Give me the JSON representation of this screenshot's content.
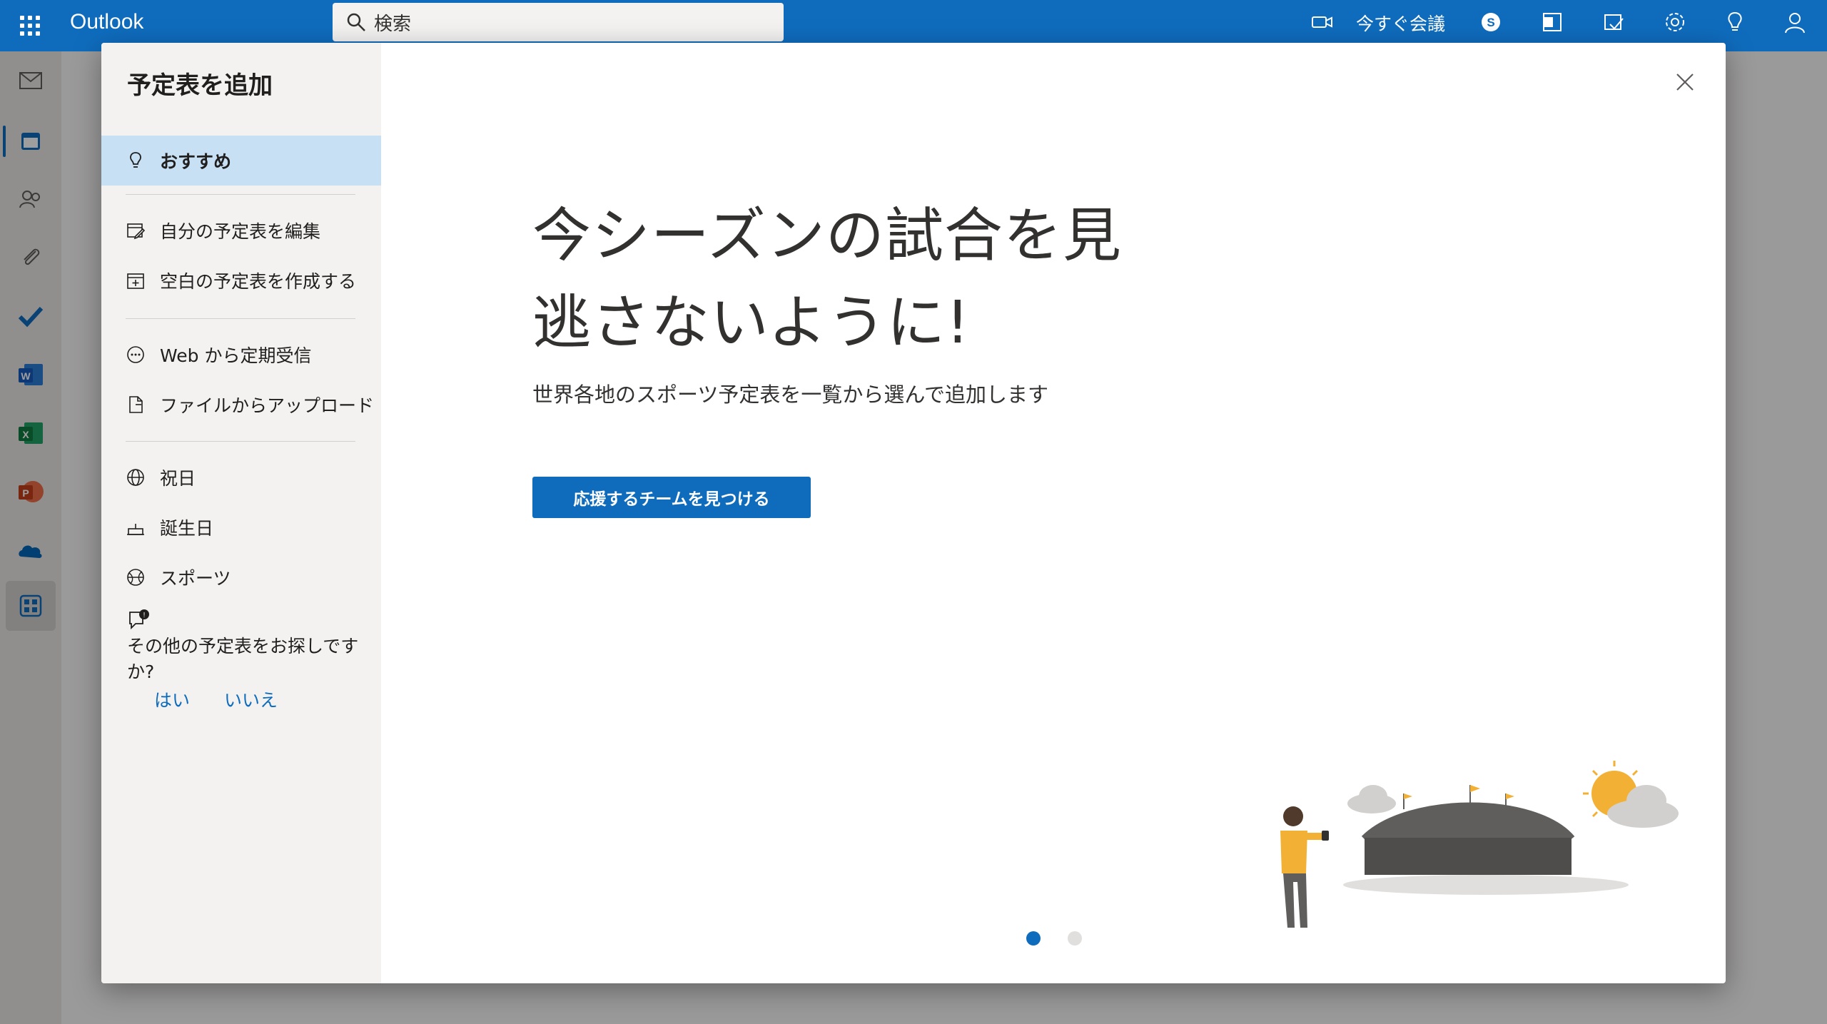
{
  "app": {
    "name": "Outlook"
  },
  "search": {
    "placeholder": "検索"
  },
  "topbar": {
    "meet_now": "今すぐ会議"
  },
  "dialog": {
    "title": "予定表を追加",
    "nav": [
      {
        "label": "おすすめ",
        "icon": "lightbulb-icon",
        "active": true
      },
      {
        "label": "自分の予定表を編集",
        "icon": "edit-calendar-icon"
      },
      {
        "label": "空白の予定表を作成する",
        "icon": "add-calendar-icon"
      },
      {
        "label": "Web から定期受信",
        "icon": "subscribe-icon"
      },
      {
        "label": "ファイルからアップロード",
        "icon": "file-upload-icon"
      },
      {
        "label": "祝日",
        "icon": "globe-icon"
      },
      {
        "label": "誕生日",
        "icon": "cake-icon"
      },
      {
        "label": "スポーツ",
        "icon": "sports-icon"
      }
    ],
    "feedback": {
      "question": "その他の予定表をお探しですか?",
      "yes": "はい",
      "no": "いいえ"
    },
    "main": {
      "headline_line1": "今シーズンの試合を見",
      "headline_line2": "逃さないように!",
      "subtitle": "世界各地のスポーツ予定表を一覧から選んで追加します",
      "cta": "応援するチームを見つける"
    },
    "carousel": {
      "current": 1,
      "total": 2
    }
  },
  "colors": {
    "accent": "#0f6cbd",
    "nav_active": "#c7e0f4"
  }
}
